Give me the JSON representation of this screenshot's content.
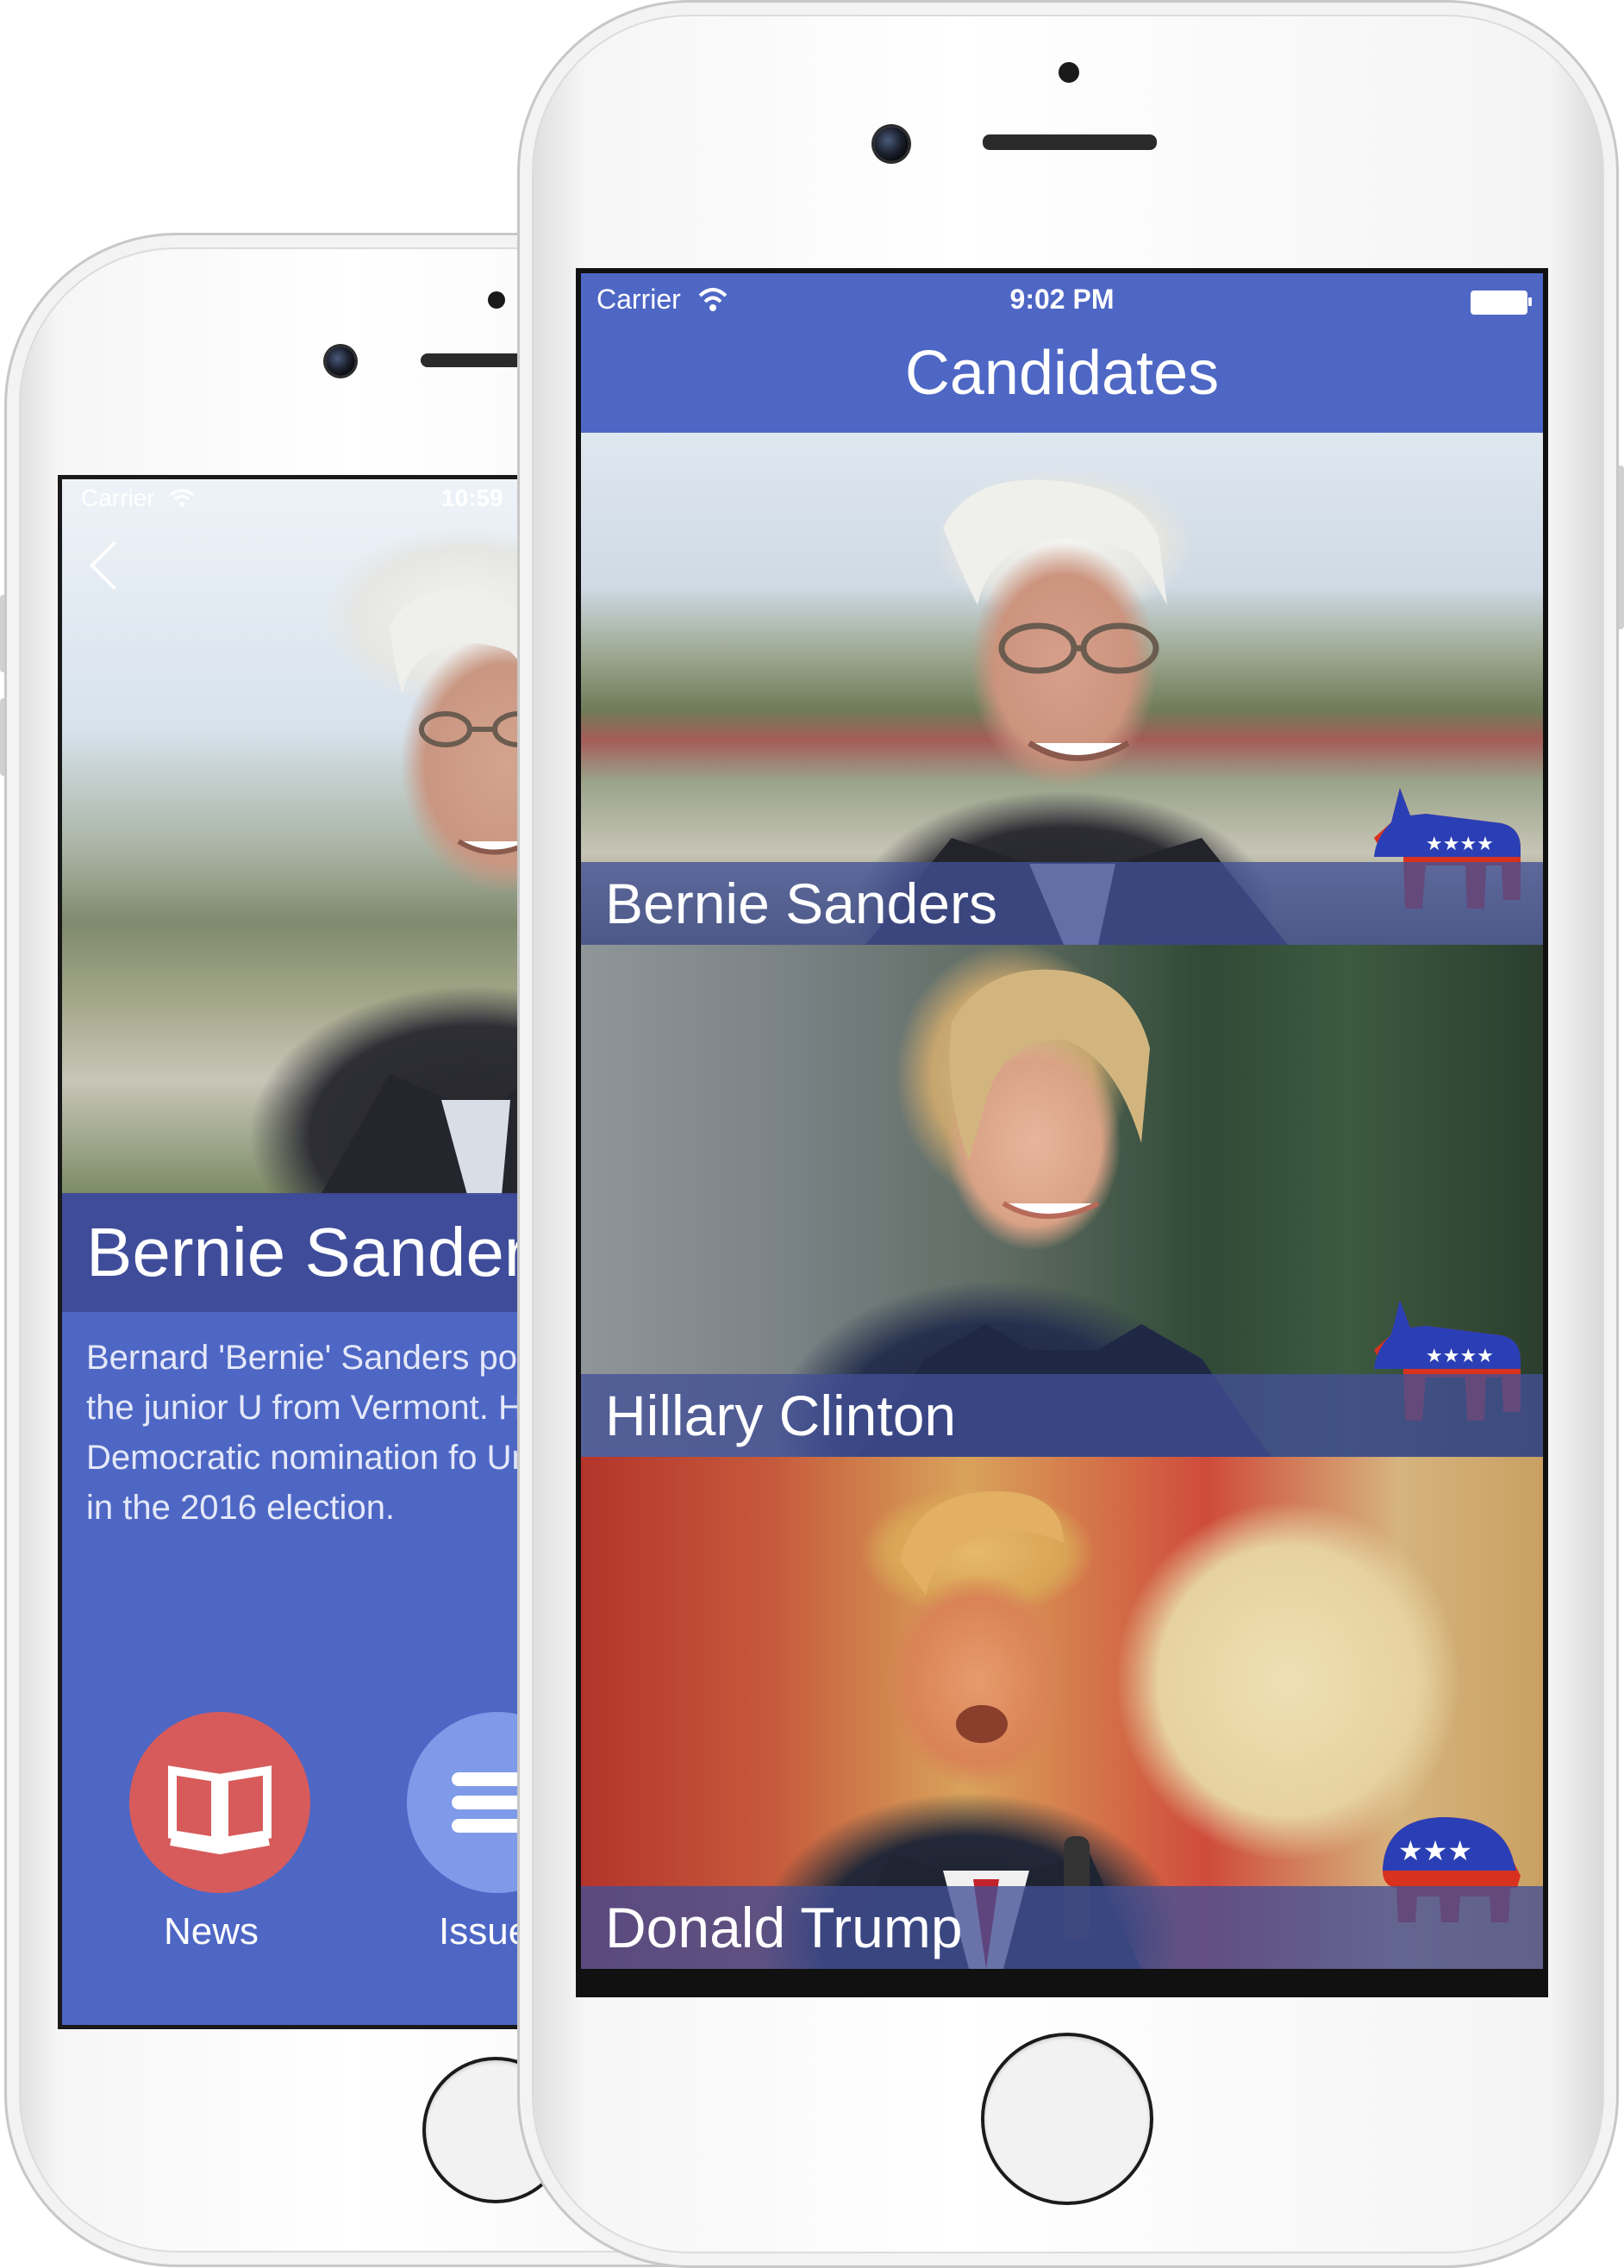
{
  "back_screen": {
    "status": {
      "carrier": "Carrier",
      "time": "10:59"
    },
    "candidate_name": "Bernie Sanders",
    "bio": "Bernard 'Bernie' Sanders politician and the junior U from Vermont. He is a can Democratic nomination fo United States in the 2016 election.",
    "buttons": [
      {
        "label": "News",
        "icon": "book-icon",
        "color": "#d75b5b"
      },
      {
        "label": "Issues",
        "icon": "list-icon",
        "color": "#7f9ae9"
      }
    ]
  },
  "front_screen": {
    "status": {
      "carrier": "Carrier",
      "time": "9:02 PM"
    },
    "title": "Candidates",
    "candidates": [
      {
        "name": "Bernie Sanders",
        "party": "democrat-donkey-icon"
      },
      {
        "name": "Hillary Clinton",
        "party": "democrat-donkey-icon"
      },
      {
        "name": "Donald Trump",
        "party": "republican-elephant-icon"
      }
    ]
  },
  "colors": {
    "accent": "#4e67c5",
    "band": "#42509a",
    "democrat_blue": "#2a3fb5",
    "republican_red": "#d8321f"
  }
}
